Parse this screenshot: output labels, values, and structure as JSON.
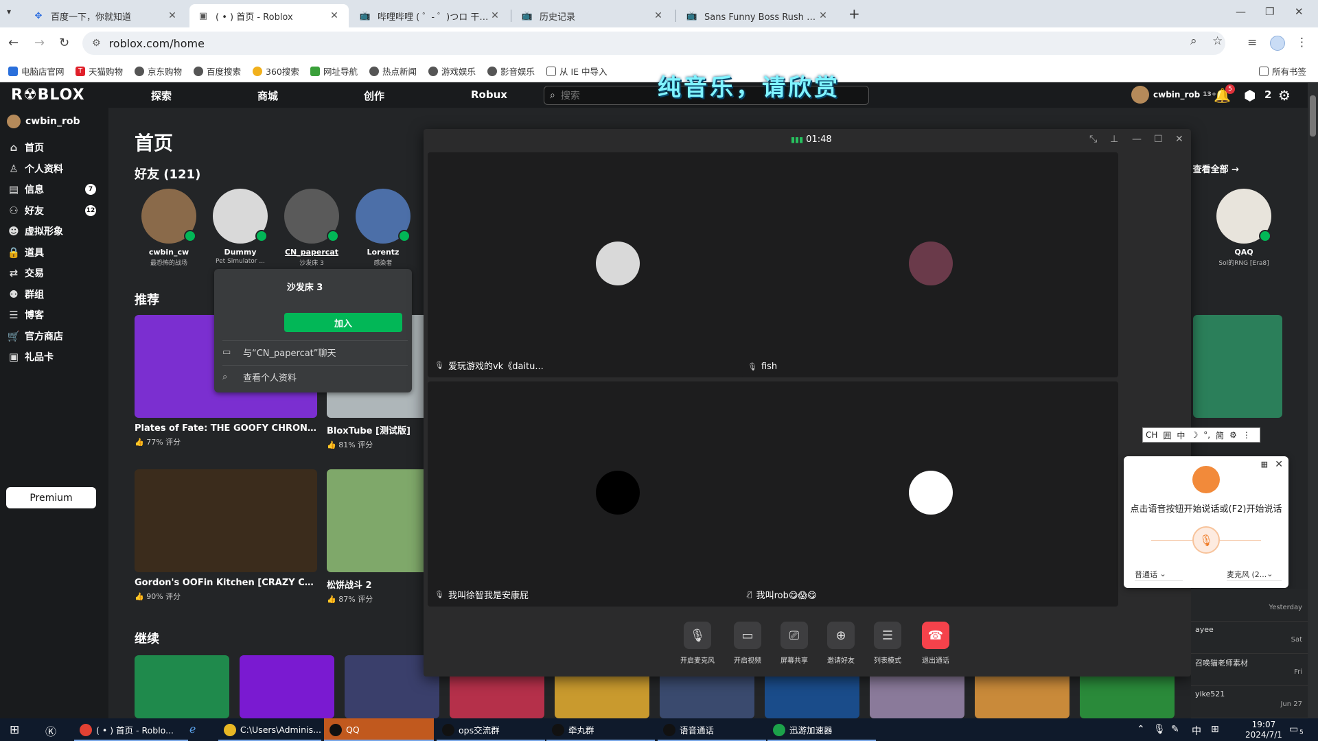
{
  "browser": {
    "tabs": [
      {
        "label": "百度一下，你就知道",
        "icon": "baidu-icon"
      },
      {
        "label": "( • ) 首页 - Roblox",
        "icon": "roblox-icon"
      },
      {
        "label": "哔哩哔哩 ( ゜- ゜)つロ 干杯~-bi",
        "icon": "bilibili-icon"
      },
      {
        "label": "历史记录",
        "icon": "bilibili-icon"
      },
      {
        "label": "Sans Funny Boss Rush 困难模",
        "icon": "bilibili-icon"
      }
    ],
    "url": "roblox.com/home",
    "bookmarks": [
      "电脑店官网",
      "天猫购物",
      "京东购物",
      "百度搜索",
      "360搜索",
      "网址导航",
      "热点新闻",
      "游戏娱乐",
      "影音娱乐",
      "从 IE 中导入"
    ],
    "all_bookmarks": "所有书签"
  },
  "roblox": {
    "logo": "R☢BLOX",
    "nav": [
      "探索",
      "商城",
      "创作",
      "Robux"
    ],
    "search_placeholder": "搜索",
    "overlay_caption": "纯音乐，请欣赏",
    "header_user": "cwbin_rob",
    "header_age": "13+",
    "notif_count": "5",
    "robux": "2",
    "sidebar": {
      "username": "cwbin_rob",
      "items": [
        {
          "label": "首页",
          "icon": "home-icon",
          "glyph": "⌂"
        },
        {
          "label": "个人资料",
          "icon": "profile-icon",
          "glyph": "♙"
        },
        {
          "label": "信息",
          "icon": "messages-icon",
          "glyph": "▤",
          "badge": "7"
        },
        {
          "label": "好友",
          "icon": "friends-icon",
          "glyph": "⚇",
          "badge": "12"
        },
        {
          "label": "虚拟形象",
          "icon": "avatar-icon",
          "glyph": "☻"
        },
        {
          "label": "道具",
          "icon": "inventory-icon",
          "glyph": "🔒"
        },
        {
          "label": "交易",
          "icon": "trade-icon",
          "glyph": "⇄"
        },
        {
          "label": "群组",
          "icon": "groups-icon",
          "glyph": "⚉"
        },
        {
          "label": "博客",
          "icon": "blog-icon",
          "glyph": "☰"
        },
        {
          "label": "官方商店",
          "icon": "store-icon",
          "glyph": "🛒"
        },
        {
          "label": "礼品卡",
          "icon": "giftcard-icon",
          "glyph": "▣"
        }
      ],
      "premium": "Premium"
    },
    "page_title": "首页",
    "friends_title": "好友 (121)",
    "see_all": "查看全部 →",
    "friends": [
      {
        "name": "cwbin_cw",
        "status": "最恐怖的战场",
        "color": "#8a6a4a"
      },
      {
        "name": "Dummy",
        "status": "Pet Simulator ...",
        "color": "#d9d9d9"
      },
      {
        "name": "CN_papercat",
        "status": "沙发床 3",
        "color": "#5a5a5a"
      },
      {
        "name": "Lorentz",
        "status": "感染者",
        "color": "#4c6fa8"
      },
      {
        "name": "QAQ",
        "status": "Sol的RNG [Era8]",
        "color": "#e8e4dc"
      }
    ],
    "friend_popup": {
      "title": "沙发床 3",
      "join": "加入",
      "chat": "与“CN_papercat”聊天",
      "profile": "查看个人资料"
    },
    "recommended_title": "推荐",
    "games": [
      {
        "name": "Plates of Fate: THE GOOFY CHRONIC...",
        "rating": "77% 评分",
        "color": "#7b2fd0"
      },
      {
        "name": "BloxTube [测试版]",
        "rating": "81% 评分",
        "color": "#aeb6b9"
      },
      {
        "name": "Gordon's OOFin Kitchen [CRAZY CHE...",
        "rating": "90% 评分",
        "color": "#3b2c1c"
      },
      {
        "name": "松饼战斗 2",
        "rating": "87% 评分",
        "color": "#7fa86a"
      }
    ],
    "continue_title": "继续",
    "continue_colors": [
      "#1f8a4c",
      "#7a1ad1",
      "#3a3f6b",
      "#b5304a",
      "#c99a2e",
      "#3a4a6e",
      "#1a4c8a",
      "#8a7a9a",
      "#c98a3a",
      "#2a8a3a"
    ]
  },
  "call": {
    "timer": "01:48",
    "participants": [
      {
        "name": "爱玩游戏的vk《daitu...",
        "color": "#d9d9d9",
        "mic": "on"
      },
      {
        "name": "fish",
        "color": "#6a3a4a",
        "mic": "on"
      },
      {
        "name": "我叫徐智我是安康屁",
        "color": "#000000",
        "mic": "on"
      },
      {
        "name": "我叫rob😋😱😋",
        "color": "#ffffff",
        "mic": "muted"
      }
    ],
    "buttons": [
      {
        "label": "开启麦克风",
        "icon": "mic-off-icon",
        "glyph": "🎙"
      },
      {
        "label": "开启视频",
        "icon": "camera-off-icon",
        "glyph": "▭"
      },
      {
        "label": "屏幕共享",
        "icon": "screen-share-icon",
        "glyph": "⎚"
      },
      {
        "label": "邀请好友",
        "icon": "invite-icon",
        "glyph": "⊕"
      },
      {
        "label": "列表模式",
        "icon": "list-icon",
        "glyph": "☰"
      },
      {
        "label": "退出通话",
        "icon": "hangup-icon",
        "glyph": "☎"
      }
    ]
  },
  "ime": {
    "items": [
      "CH",
      "囲",
      "中",
      "☽",
      "°,",
      "简",
      "⚙",
      "⋮"
    ]
  },
  "voice_input": {
    "hint": "点击语音按钮开始说话或(F2)开始说话",
    "lang": "普通话",
    "device": "麦克风 (2..."
  },
  "chat_list": [
    {
      "name": "",
      "time": "Yesterday"
    },
    {
      "name": "ayee",
      "time": "Sat"
    },
    {
      "name": "召唤猫老师素材",
      "time": "Fri"
    },
    {
      "name": "yike521",
      "time": "Jun 27"
    }
  ],
  "taskbar": {
    "items": [
      {
        "label": "( • ) 首页 - Roblo...",
        "icon": "chrome-icon",
        "color": "#e34133"
      },
      {
        "label": "C:\\Users\\Adminis...",
        "icon": "folder-icon",
        "color": "#e9b824"
      },
      {
        "label": "QQ",
        "icon": "qq-icon",
        "color": "#111111",
        "active": true
      },
      {
        "label": "ops交流群",
        "icon": "qq-icon",
        "color": "#111111"
      },
      {
        "label": "牵丸群",
        "icon": "qq-icon",
        "color": "#111111"
      },
      {
        "label": "语音通话",
        "icon": "qq-icon",
        "color": "#111111"
      },
      {
        "label": "迅游加速器",
        "icon": "accelerator-icon",
        "color": "#1ca24a"
      }
    ],
    "time": "19:07",
    "date": "2024/7/1",
    "ime": "中",
    "notif": "5"
  }
}
